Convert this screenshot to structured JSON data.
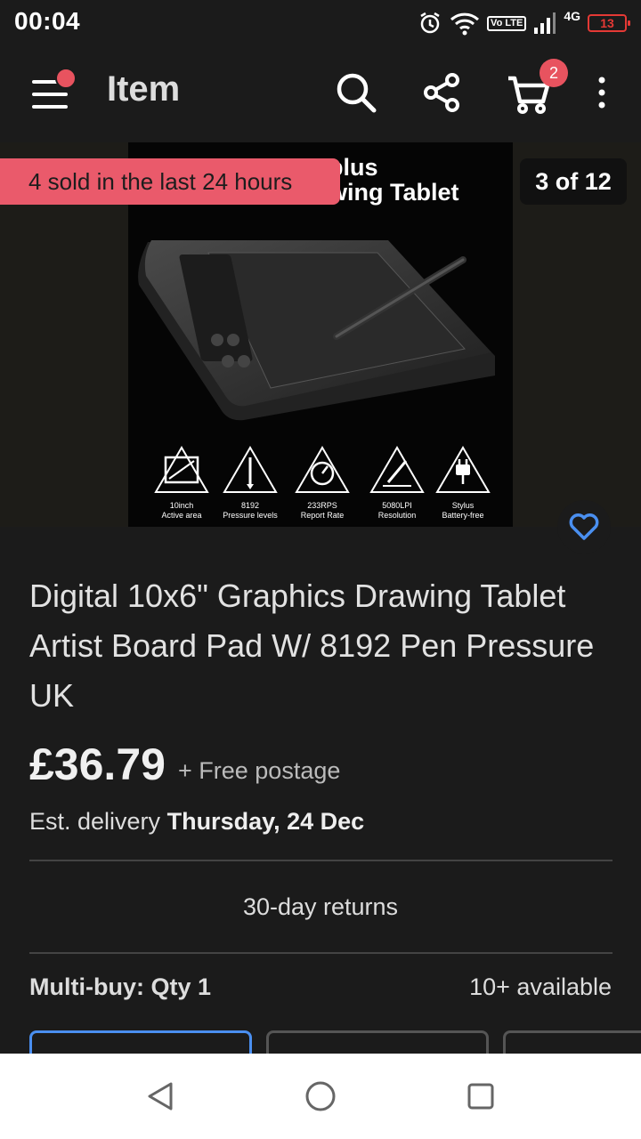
{
  "status_bar": {
    "time": "00:04",
    "lte": "Vo LTE",
    "network": "4G",
    "battery": "13"
  },
  "header": {
    "title": "Item",
    "cart_count": "2"
  },
  "gallery": {
    "sold_banner": "4 sold in the last 24 hours",
    "counter": "3 of 12",
    "image_title": "060plus\nDrawing Tablet",
    "features": [
      {
        "icon": "tablet-icon",
        "text": "10inch\nActive area"
      },
      {
        "icon": "pen-icon",
        "text": "8192\nPressure levels"
      },
      {
        "icon": "gauge-icon",
        "text": "233RPS\nReport Rate"
      },
      {
        "icon": "pen-nib-icon",
        "text": "5080LPI\nResolution"
      },
      {
        "icon": "plug-icon",
        "text": "Stylus\nBattery-free"
      }
    ]
  },
  "product": {
    "title": "Digital 10x6\" Graphics Drawing Tablet Artist Board Pad W/ 8192 Pen Pressure UK",
    "price": "£36.79",
    "postage": "+ Free postage",
    "delivery_label": "Est. delivery",
    "delivery_date": "Thursday, 24 Dec",
    "returns": "30-day returns",
    "multibuy": "Multi-buy: Qty 1",
    "available": "10+ available"
  },
  "colors": {
    "accent": "#e8535f",
    "link": "#4a8ff0",
    "background": "#1b1b1b"
  }
}
